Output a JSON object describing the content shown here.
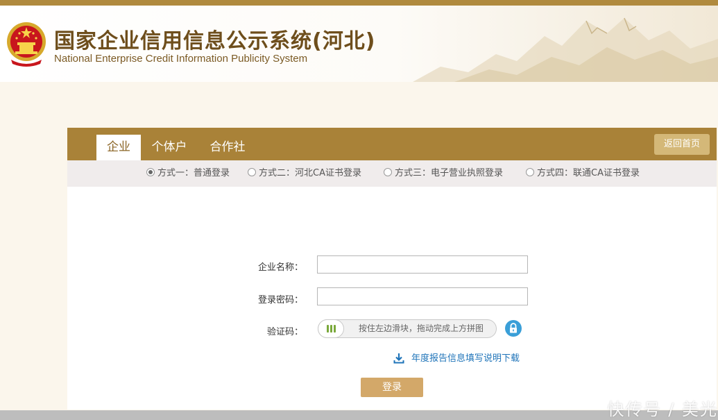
{
  "header": {
    "title": "国家企业信用信息公示系统(河北)",
    "subtitle": "National Enterprise Credit Information Publicity System"
  },
  "tabs": [
    {
      "label": "企业",
      "active": true
    },
    {
      "label": "个体户",
      "active": false
    },
    {
      "label": "合作社",
      "active": false
    }
  ],
  "back_home_label": "返回首页",
  "login_methods": [
    {
      "label": "方式一：普通登录",
      "selected": true
    },
    {
      "label": "方式二：河北CA证书登录",
      "selected": false
    },
    {
      "label": "方式三：电子营业执照登录",
      "selected": false
    },
    {
      "label": "方式四：联通CA证书登录",
      "selected": false
    }
  ],
  "form": {
    "company_name_label": "企业名称：",
    "company_name_value": "",
    "password_label": "登录密码：",
    "password_value": "",
    "captcha_label": "验证码：",
    "slider_text": "按住左边滑块，拖动完成上方拼图",
    "download_text": "年度报告信息填写说明下载",
    "login_button": "登录"
  },
  "watermark": "快传号 / 美光",
  "colors": {
    "brand_gold": "#a98238",
    "button_gold": "#d3a869",
    "link_blue": "#1f74b9",
    "lock_blue": "#3a9fd8"
  },
  "icons": {
    "emblem": "national-emblem-icon",
    "lock": "lock-icon",
    "download": "download-icon",
    "slider_handle": "grip-icon"
  }
}
